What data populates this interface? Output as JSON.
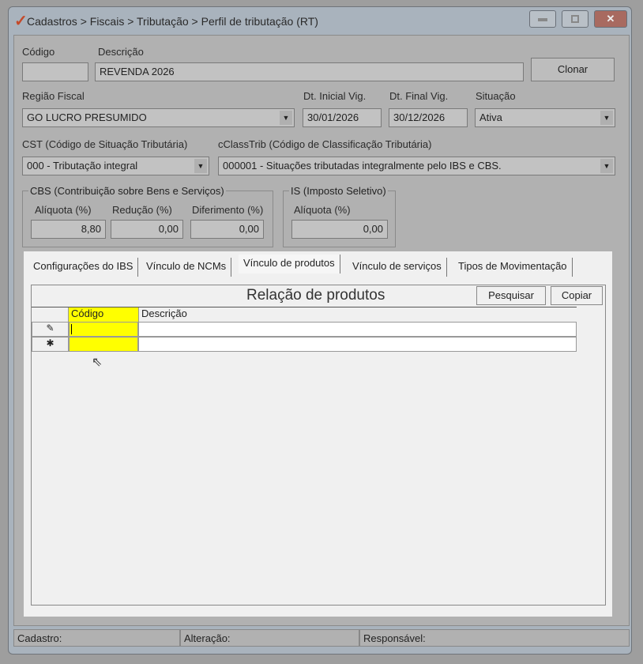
{
  "window": {
    "title": "Cadastros > Fiscais > Tributação > Perfil de tributação (RT)"
  },
  "form": {
    "codigo_label": "Código",
    "codigo_value": "",
    "descricao_label": "Descrição",
    "descricao_value": "REVENDA 2026",
    "clonar": "Clonar",
    "regiao_label": "Região Fiscal",
    "regiao_value": "GO LUCRO PRESUMIDO",
    "dt_inicial_label": "Dt. Inicial Vig.",
    "dt_inicial_value": "30/01/2026",
    "dt_final_label": "Dt. Final Vig.",
    "dt_final_value": "30/12/2026",
    "situacao_label": "Situação",
    "situacao_value": "Ativa",
    "cst_label": "CST (Código de Situação Tributária)",
    "cst_value": "000 - Tributação integral",
    "cclass_label": "cClassTrib (Código de Classificação Tributária)",
    "cclass_value": "000001 - Situações tributadas integralmente pelo IBS e CBS."
  },
  "cbs": {
    "title": "CBS (Contribuição sobre Bens e Serviços)",
    "aliquota_label": "Alíquota (%)",
    "aliquota": "8,80",
    "reducao_label": "Redução (%)",
    "reducao": "0,00",
    "diferimento_label": "Diferimento (%)",
    "diferimento": "0,00"
  },
  "is": {
    "title": "IS (Imposto Seletivo)",
    "aliquota_label": "Alíquota (%)",
    "aliquota": "0,00"
  },
  "tabs": [
    "Configurações do IBS",
    "Vínculo de NCMs",
    "Vínculo de produtos",
    "Vínculo de serviços",
    "Tipos de Movimentação"
  ],
  "grid": {
    "title": "Relação de produtos",
    "pesquisar": "Pesquisar",
    "copiar": "Copiar",
    "columns": [
      "Código",
      "Descrição"
    ],
    "row_edit_icon": "✎",
    "row_new_icon": "✱"
  },
  "status": {
    "cadastro": "Cadastro:",
    "alteracao": "Alteração:",
    "responsavel": "Responsável:"
  },
  "colors": {
    "highlight": "#ffff00"
  }
}
